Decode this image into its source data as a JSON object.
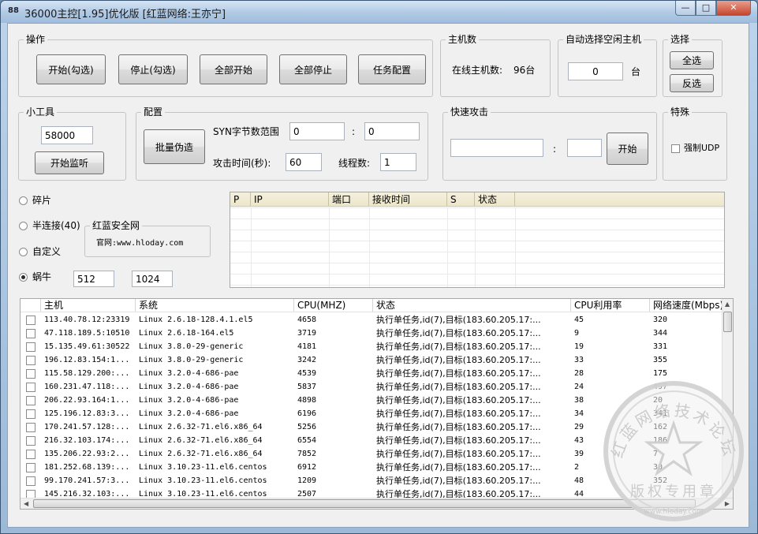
{
  "window": {
    "title": "36000主控[1.95]优化版 [红蓝网络:王亦宁]",
    "minimize": "—",
    "maximize": "□",
    "close": "✕",
    "app_icon": "88"
  },
  "ops": {
    "title": "操作",
    "start_checked": "开始(勾选)",
    "stop_checked": "停止(勾选)",
    "start_all": "全部开始",
    "stop_all": "全部停止",
    "task_config": "任务配置"
  },
  "host_count": {
    "title": "主机数",
    "online_label": "在线主机数:",
    "online_value": "96台"
  },
  "auto_select": {
    "title": "自动选择空闲主机",
    "value": "0",
    "unit": "台"
  },
  "select": {
    "title": "选择",
    "select_all": "全选",
    "invert": "反选"
  },
  "tools": {
    "title": "小工具",
    "port_value": "58000",
    "start_monitor": "开始监听"
  },
  "config": {
    "title": "配置",
    "batch_fake": "批量伪造",
    "syn_label": "SYN字节数范围",
    "syn_min": "0",
    "colon": ":",
    "syn_max": "0",
    "attack_time_label": "攻击时间(秒):",
    "attack_time": "60",
    "threads_label": "线程数:",
    "threads": "1"
  },
  "quick_attack": {
    "title": "快速攻击",
    "target": "",
    "colon": ":",
    "port": "",
    "start": "开始"
  },
  "special": {
    "title": "特殊",
    "force_udp": "强制UDP"
  },
  "modes": {
    "fragment": "碎片",
    "half_conn": "半连接(40)",
    "custom": "自定义",
    "snail": "蜗牛",
    "snail_v1": "512",
    "snail_v2": "1024",
    "selected": "snail"
  },
  "promo": {
    "title": "红蓝安全网",
    "site": "官网:www.hloday.com"
  },
  "conn_list": {
    "columns": [
      "P",
      "IP",
      "端口",
      "接收时间",
      "S",
      "状态"
    ]
  },
  "hosts": {
    "columns": [
      "",
      "主机",
      "系统",
      "CPU(MHZ)",
      "状态",
      "CPU利用率",
      "网络速度(Mbps)"
    ],
    "rows": [
      [
        "113.40.78.12:23319",
        "Linux 2.6.18-128.4.1.el5",
        "4658",
        "执行单任务,id(7),目标(183.60.205.17:...",
        "45",
        "320"
      ],
      [
        "47.118.189.5:10510",
        "Linux 2.6.18-164.el5",
        "3719",
        "执行单任务,id(7),目标(183.60.205.17:...",
        "9",
        "344"
      ],
      [
        "15.135.49.61:30522",
        "Linux 3.8.0-29-generic",
        "4181",
        "执行单任务,id(7),目标(183.60.205.17:...",
        "19",
        "331"
      ],
      [
        "196.12.83.154:1...",
        "Linux 3.8.0-29-generic",
        "3242",
        "执行单任务,id(7),目标(183.60.205.17:...",
        "33",
        "355"
      ],
      [
        "115.58.129.200:...",
        "Linux 3.2.0-4-686-pae",
        "4539",
        "执行单任务,id(7),目标(183.60.205.17:...",
        "28",
        "175"
      ],
      [
        "160.231.47.118:...",
        "Linux 3.2.0-4-686-pae",
        "5837",
        "执行单任务,id(7),目标(183.60.205.17:...",
        "24",
        "497"
      ],
      [
        "206.22.93.164:1...",
        "Linux 3.2.0-4-686-pae",
        "4898",
        "执行单任务,id(7),目标(183.60.205.17:...",
        "38",
        "20"
      ],
      [
        "125.196.12.83:3...",
        "Linux 3.2.0-4-686-pae",
        "6196",
        "执行单任务,id(7),目标(183.60.205.17:...",
        "34",
        "341"
      ],
      [
        "170.241.57.128:...",
        "Linux 2.6.32-71.el6.x86_64",
        "5256",
        "执行单任务,id(7),目标(183.60.205.17:...",
        "29",
        "162"
      ],
      [
        "216.32.103.174:...",
        "Linux 2.6.32-71.el6.x86_64",
        "6554",
        "执行单任务,id(7),目标(183.60.205.17:...",
        "43",
        "186"
      ],
      [
        "135.206.22.93:2...",
        "Linux 2.6.32-71.el6.x86_64",
        "7852",
        "执行单任务,id(7),目标(183.60.205.17:...",
        "39",
        "7"
      ],
      [
        "181.252.68.139:...",
        "Linux 3.10.23-11.el6.centos",
        "6912",
        "执行单任务,id(7),目标(183.60.205.17:...",
        "2",
        "30"
      ],
      [
        "99.170.241.57:3...",
        "Linux 3.10.23-11.el6.centos",
        "1209",
        "执行单任务,id(7),目标(183.60.205.17:...",
        "48",
        "352"
      ],
      [
        "145.216.32.103:...",
        "Linux 3.10.23-11.el6.centos",
        "2507",
        "执行单任务,id(7),目标(183.60.205.17:...",
        "44",
        ""
      ]
    ]
  },
  "stamp": {
    "text_top": "红蓝网络技术论坛",
    "text_bottom": "版权专用章",
    "url": "www.hloday.com"
  }
}
